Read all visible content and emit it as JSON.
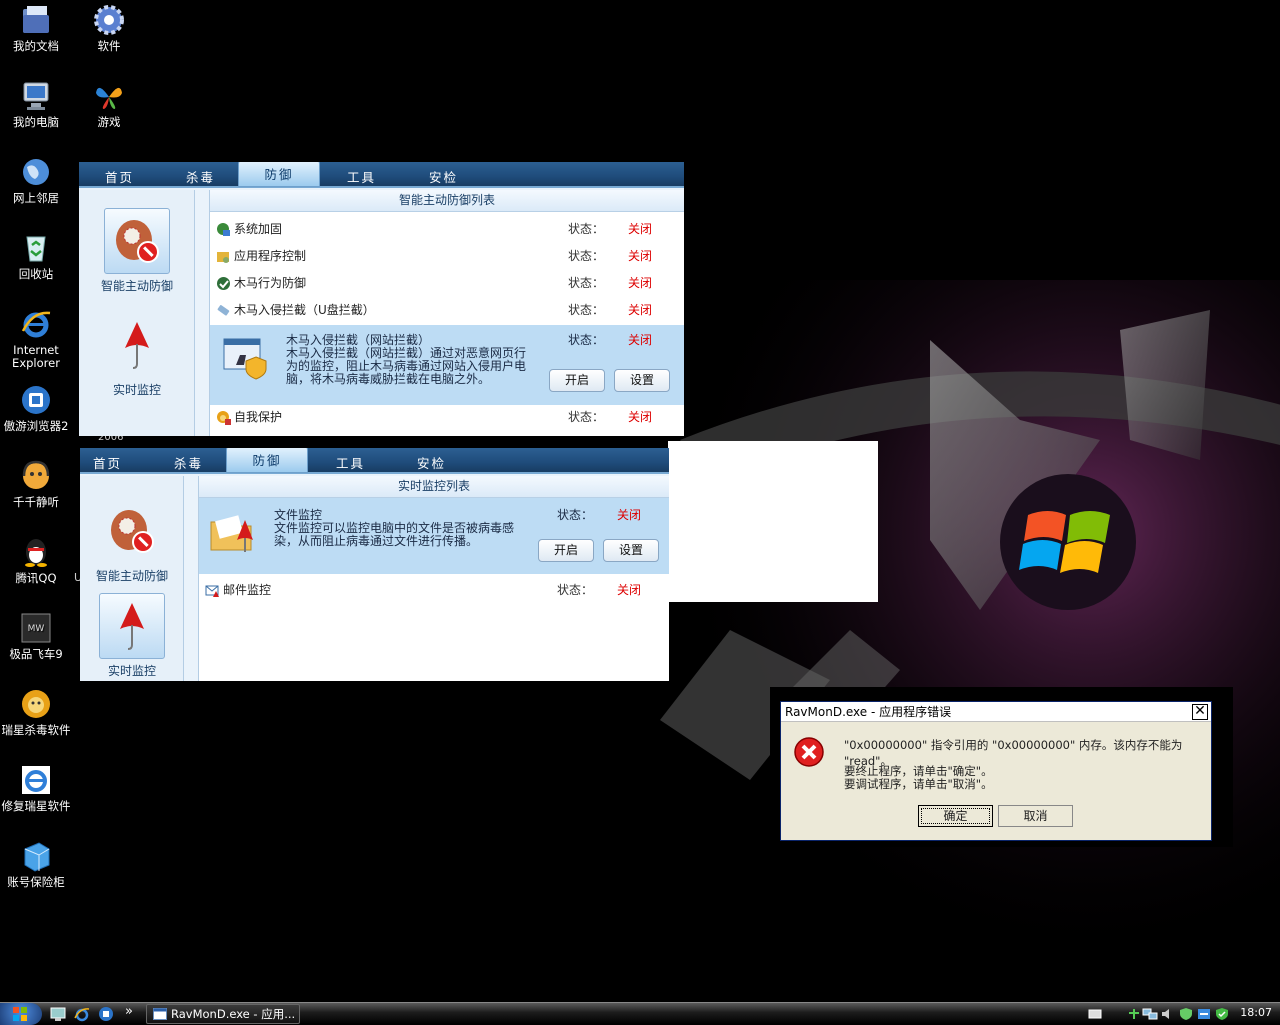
{
  "desktop": {
    "icons": [
      {
        "label": "我的文档",
        "icon": "folder-documents-icon"
      },
      {
        "label": "软件",
        "icon": "gear-icon"
      },
      {
        "label": "我的电脑",
        "icon": "computer-icon"
      },
      {
        "label": "游戏",
        "icon": "msn-butterfly-icon"
      },
      {
        "label": "网上邻居",
        "icon": "network-globe-icon"
      },
      {
        "label": "回收站",
        "icon": "recycle-bin-icon"
      },
      {
        "label": "Internet Explorer",
        "icon": "internet-explorer-icon"
      },
      {
        "label": "傲游浏览器2",
        "icon": "maxthon-browser-icon"
      },
      {
        "label": "千千静听",
        "icon": "ttplayer-icon"
      },
      {
        "label": "腾讯QQ",
        "icon": "qq-penguin-icon"
      },
      {
        "label": "极品飞车9",
        "icon": "nfs-game-icon"
      },
      {
        "label": "瑞星杀毒软件",
        "icon": "rising-lion-icon"
      },
      {
        "label": "修复瑞星软件",
        "icon": "internet-explorer-icon"
      },
      {
        "label": "账号保险柜",
        "icon": "safe-box-icon"
      }
    ],
    "partial_text_1": "2006",
    "partial_text_2": "U"
  },
  "rising_window_1": {
    "tabs": [
      "首页",
      "杀毒",
      "防御",
      "工具",
      "安检"
    ],
    "active_tab": "防御",
    "side_buttons": [
      {
        "label": "智能主动防御",
        "icon": "baseball-glove-shield-icon",
        "selected": true
      },
      {
        "label": "实时监控",
        "icon": "red-umbrella-icon",
        "selected": false
      }
    ],
    "list_title": "智能主动防御列表",
    "rows": [
      {
        "label": "系统加固",
        "icon": "system-harden-icon",
        "status_label": "状态：",
        "status": "关闭"
      },
      {
        "label": "应用程序控制",
        "icon": "app-control-icon",
        "status_label": "状态：",
        "status": "关闭"
      },
      {
        "label": "木马行为防御",
        "icon": "trojan-behavior-icon",
        "status_label": "状态：",
        "status": "关闭"
      },
      {
        "label": "木马入侵拦截（U盘拦截）",
        "icon": "usb-intercept-icon",
        "status_label": "状态：",
        "status": "关闭"
      }
    ],
    "expanded": {
      "title": "木马入侵拦截（网站拦截）",
      "description": "木马入侵拦截（网站拦截）通过对恶意网页行为的监控，阻止木马病毒通过网站入侵用户电脑，将木马病毒威胁拦截在电脑之外。",
      "status_label": "状态：",
      "status": "关闭",
      "enable_label": "开启",
      "settings_label": "设置",
      "icon": "web-intercept-shield-icon"
    },
    "last_row": {
      "label": "自我保护",
      "icon": "self-protect-icon",
      "status_label": "状态：",
      "status": "关闭"
    }
  },
  "rising_window_2": {
    "tabs": [
      "首页",
      "杀毒",
      "防御",
      "工具",
      "安检"
    ],
    "active_tab": "防御",
    "side_buttons": [
      {
        "label": "智能主动防御",
        "icon": "baseball-glove-shield-icon",
        "selected": false
      },
      {
        "label": "实时监控",
        "icon": "red-umbrella-icon",
        "selected": true
      }
    ],
    "list_title": "实时监控列表",
    "expanded": {
      "title": "文件监控",
      "description": "文件监控可以监控电脑中的文件是否被病毒感染，从而阻止病毒通过文件进行传播。",
      "status_label": "状态：",
      "status": "关闭",
      "enable_label": "开启",
      "settings_label": "设置",
      "icon": "folder-umbrella-icon"
    },
    "rows": [
      {
        "label": "邮件监控",
        "icon": "mail-monitor-icon",
        "status_label": "状态：",
        "status": "关闭"
      }
    ]
  },
  "error_dialog": {
    "title": "RavMonD.exe - 应用程序错误",
    "message": "\"0x00000000\" 指令引用的 \"0x00000000\" 内存。该内存不能为 \"read\"。",
    "line2": "要终止程序，请单击\"确定\"。",
    "line3": "要调试程序，请单击\"取消\"。",
    "ok_label": "确定",
    "cancel_label": "取消",
    "close_glyph": "✕"
  },
  "taskbar": {
    "overflow_glyph": "»",
    "task_label": "RavMonD.exe - 应用...",
    "clock": "18:07"
  }
}
